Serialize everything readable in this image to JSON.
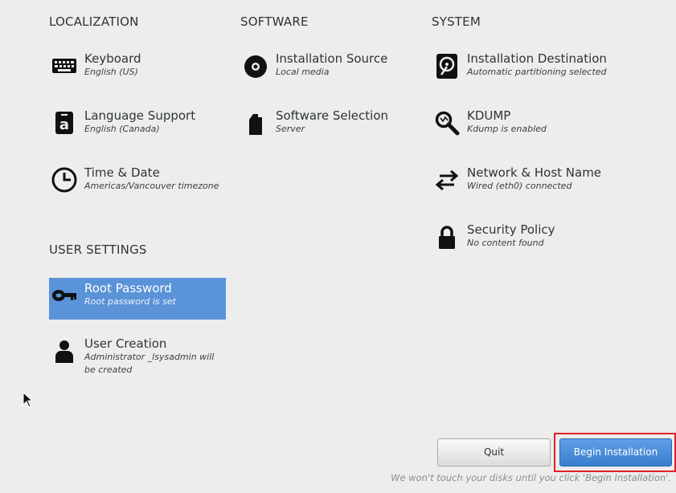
{
  "sections": {
    "localization": "LOCALIZATION",
    "software": "SOFTWARE",
    "system": "SYSTEM",
    "user_settings": "USER SETTINGS"
  },
  "localization": {
    "keyboard": {
      "title": "Keyboard",
      "status": "English (US)",
      "icon": "keyboard-icon"
    },
    "language": {
      "title": "Language Support",
      "status": "English (Canada)",
      "icon": "language-icon"
    },
    "time": {
      "title": "Time & Date",
      "status": "Americas/Vancouver timezone",
      "icon": "clock-icon"
    }
  },
  "software": {
    "source": {
      "title": "Installation Source",
      "status": "Local media",
      "icon": "disc-icon"
    },
    "selection": {
      "title": "Software Selection",
      "status": "Server",
      "icon": "package-icon"
    }
  },
  "system": {
    "destination": {
      "title": "Installation Destination",
      "status": "Automatic partitioning selected",
      "icon": "harddisk-icon"
    },
    "kdump": {
      "title": "KDUMP",
      "status": "Kdump is enabled",
      "icon": "magnifier-icon"
    },
    "network": {
      "title": "Network & Host Name",
      "status": "Wired (eth0) connected",
      "icon": "network-arrows-icon"
    },
    "security": {
      "title": "Security Policy",
      "status": "No content found",
      "icon": "lock-icon"
    }
  },
  "user_settings": {
    "root": {
      "title": "Root Password",
      "status": "Root password is set",
      "icon": "key-icon",
      "selected": true
    },
    "user": {
      "title": "User Creation",
      "status": "Administrator _lsysadmin will be created",
      "icon": "user-icon"
    }
  },
  "buttons": {
    "quit": "Quit",
    "begin": "Begin Installation"
  },
  "footer_note": "We won't touch your disks until you click 'Begin Installation'.",
  "colors": {
    "background": "#ededed",
    "selected_spoke": "#5a93d8",
    "primary_button": "#3a7dce",
    "highlight_frame": "#e0202a"
  }
}
